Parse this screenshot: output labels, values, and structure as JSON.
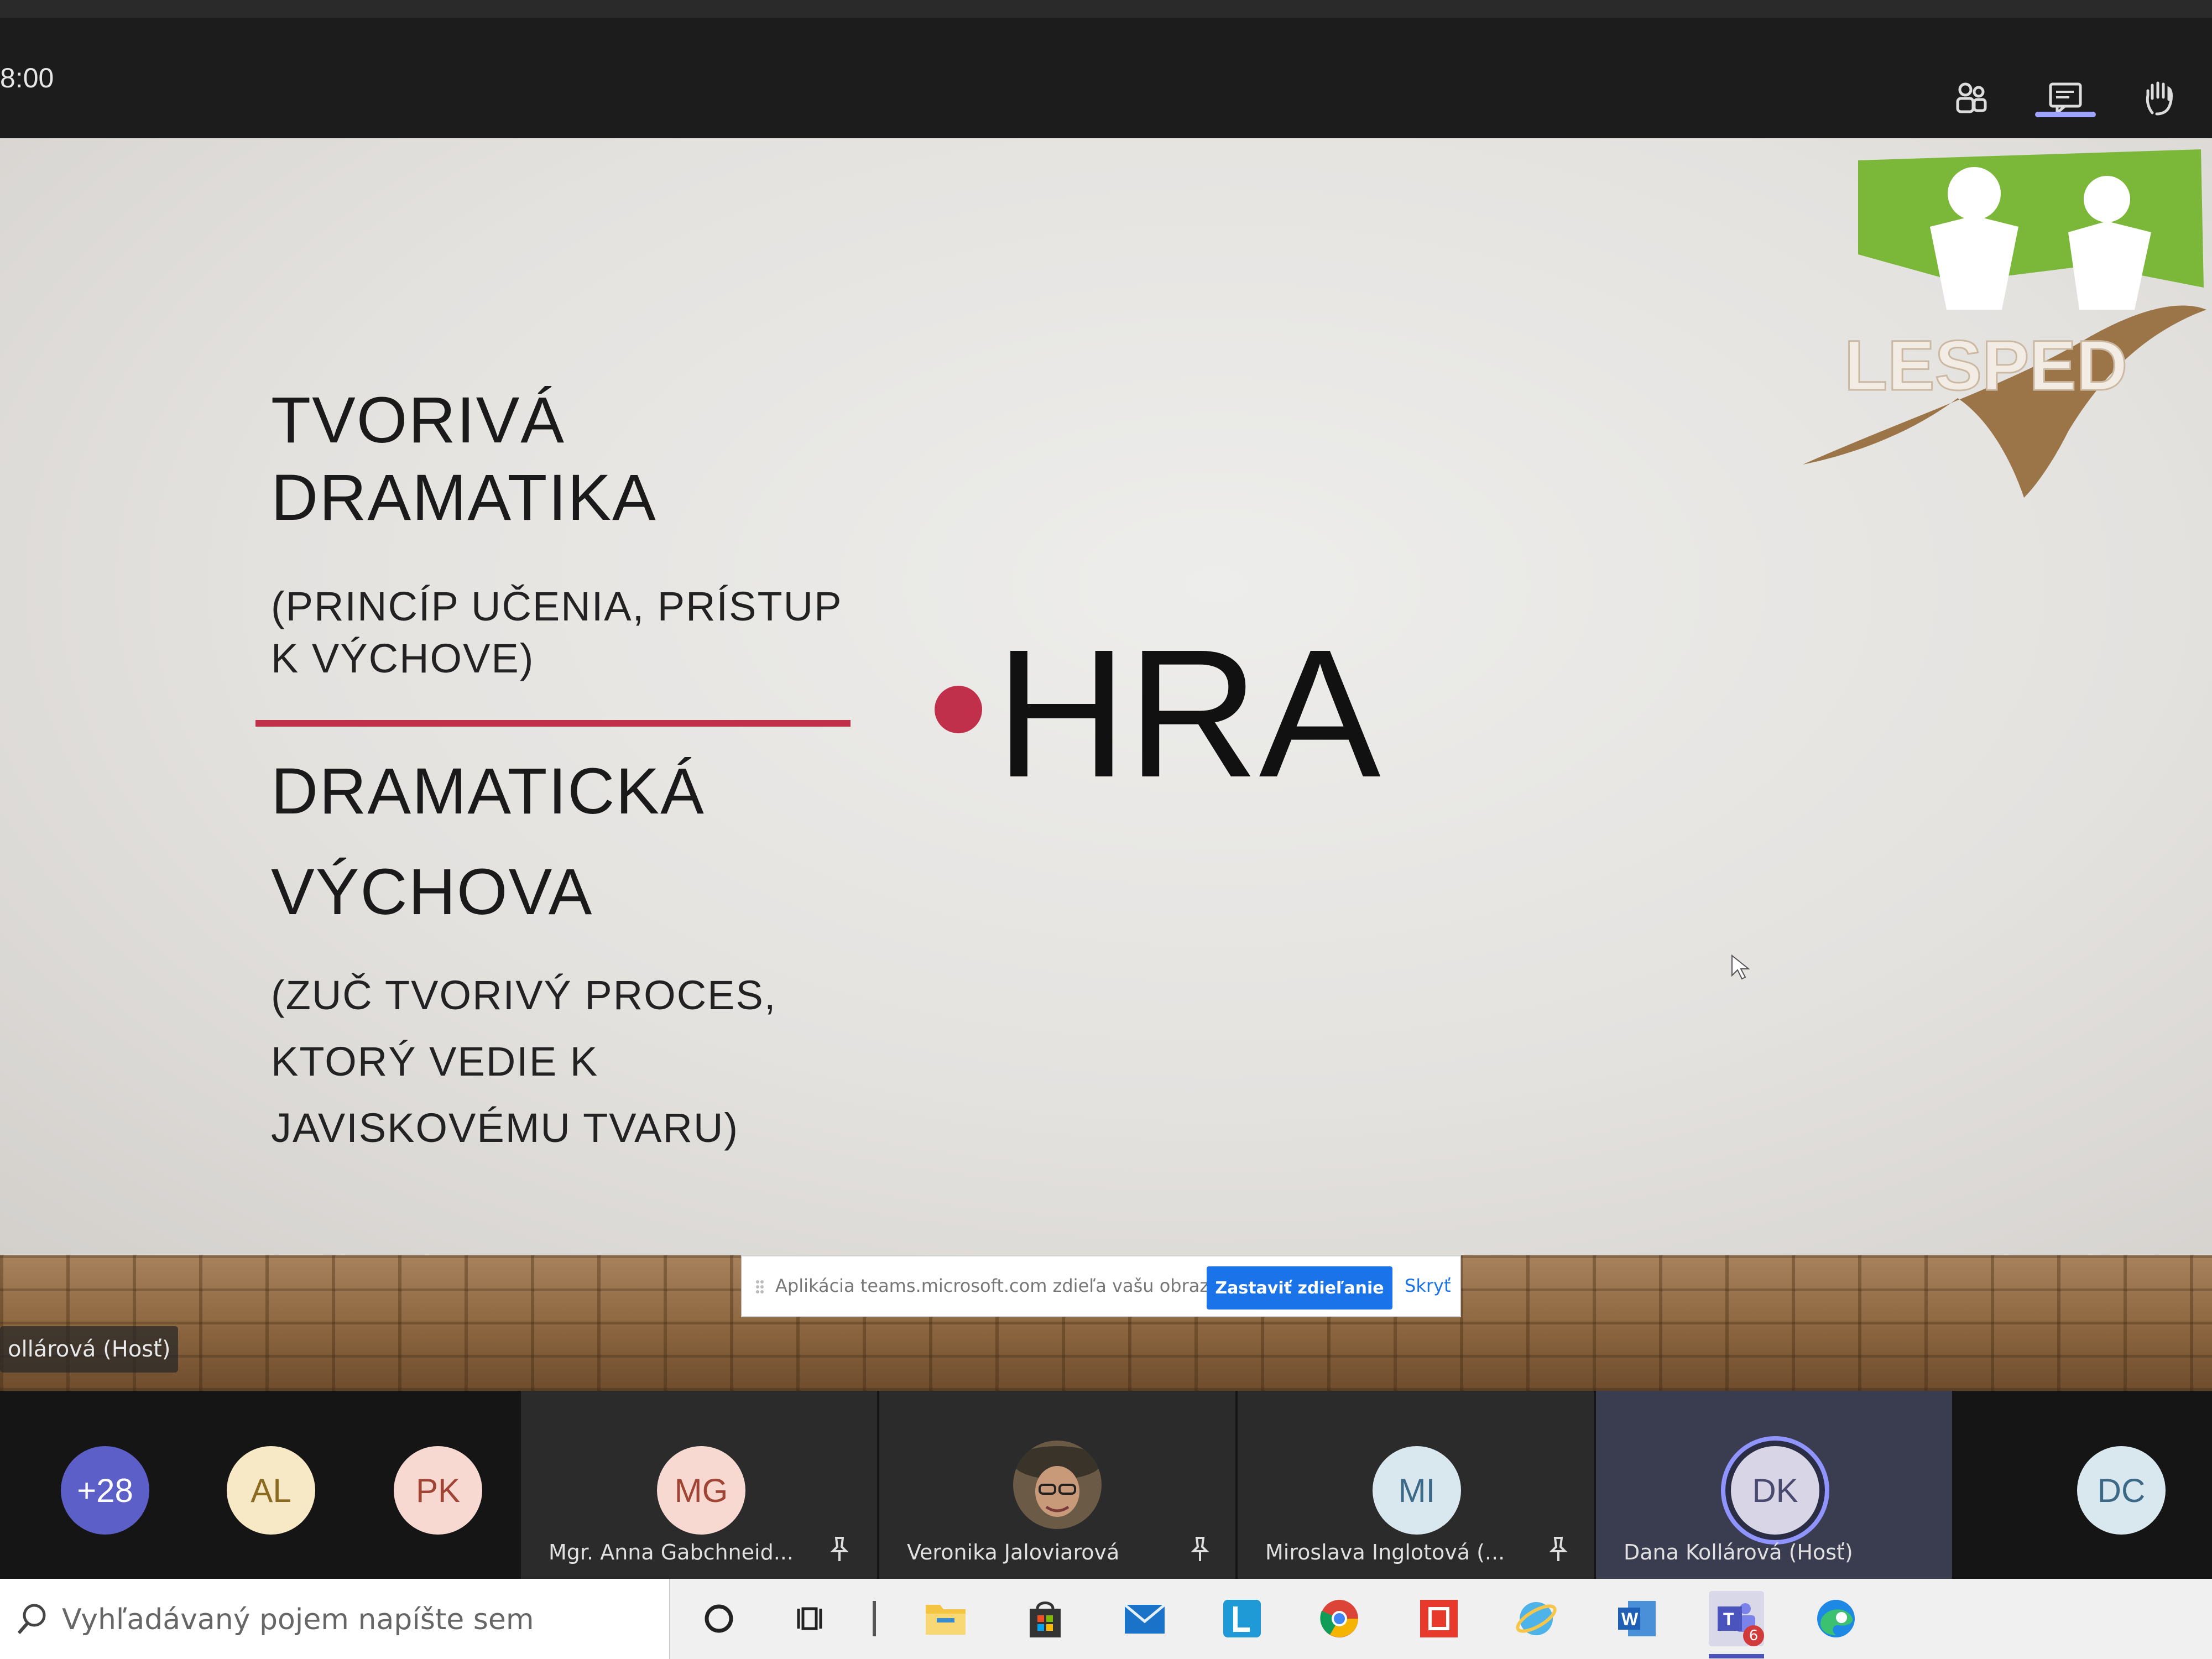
{
  "meeting": {
    "timer": "8:00",
    "toolbar": [
      "participants-icon",
      "chat-icon",
      "raise-hand-icon"
    ],
    "accent": "#9da3ff"
  },
  "slide": {
    "title1_line1": "TVORIVÁ",
    "title1_line2": "DRAMATIKA",
    "sub1_line1": "(PRINCÍP UČENIA, PRÍSTUP",
    "sub1_line2": "K VÝCHOVE)",
    "title2_line1": "DRAMATICKÁ",
    "title2_line2": "VÝCHOVA",
    "sub2_line1": "(ZUČ TVORIVÝ PROCES,",
    "sub2_line2": "KTORÝ VEDIE K",
    "sub2_line3": "JAVISKOVÉMU TVARU)",
    "bullet": "HRA",
    "logo_text": "LESPED",
    "accent": "#c0304a"
  },
  "notification": {
    "text": "Aplikácia teams.microsoft.com zdieľa vašu obrazovku.",
    "primary": "Zastaviť zdieľanie",
    "secondary": "Skryť"
  },
  "presenter_label": "ollárová (Hosť)",
  "participants": [
    {
      "initials": "+28",
      "name": "",
      "bg": "#5b5fc7",
      "fg": "#ffffff"
    },
    {
      "initials": "AL",
      "name": "",
      "bg": "#f7e9c6",
      "fg": "#8a6a1e"
    },
    {
      "initials": "PK",
      "name": "",
      "bg": "#f7d9d2",
      "fg": "#a04434"
    },
    {
      "initials": "MG",
      "name": "Mgr. Anna Gabchneid...",
      "bg": "#f7d9d2",
      "fg": "#a04434"
    },
    {
      "initials": "",
      "name": "Veronika Jaloviarová",
      "bg": "#6b5a45",
      "fg": "#ffffff"
    },
    {
      "initials": "MI",
      "name": "Miroslava Inglotová (...",
      "bg": "#d9e7ef",
      "fg": "#3c6a86"
    },
    {
      "initials": "DK",
      "name": "Dana Kollárová (Hosť)",
      "bg": "#d8d6e6",
      "fg": "#4a4a70"
    },
    {
      "initials": "DC",
      "name": "",
      "bg": "#d9e7ef",
      "fg": "#3c6a86"
    }
  ],
  "taskbar": {
    "search_placeholder": "Vyhľadávaný pojem napíšte sem",
    "badge": "6",
    "apps": [
      "cortana-icon",
      "task-view-icon",
      "file-explorer-icon",
      "store-icon",
      "mail-icon",
      "linkedin-learning-icon",
      "chrome-icon",
      "office-icon",
      "browser-icon",
      "word-icon",
      "teams-icon",
      "edge-icon"
    ]
  }
}
